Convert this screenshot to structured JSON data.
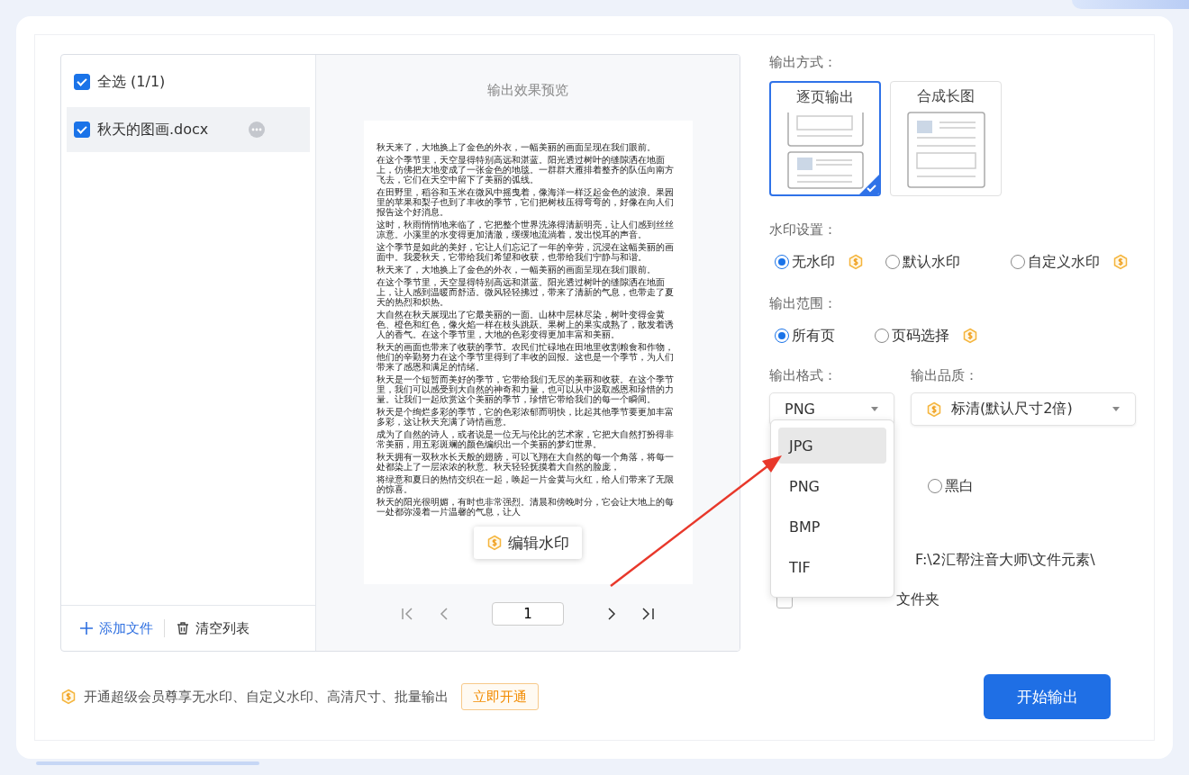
{
  "file_list": {
    "select_all": {
      "label": "全选 (1/1)",
      "checked": true
    },
    "files": [
      {
        "name": "秋天的图画.docx",
        "checked": true,
        "selected": true
      }
    ],
    "add_button": "添加文件",
    "clear_button": "清空列表"
  },
  "preview": {
    "title": "输出效果预览",
    "paragraphs": [
      "秋天来了，大地换上了金色的外衣，一幅美丽的画面呈现在我们眼前。",
      "在这个季节里，天空显得特别高远和湛蓝。阳光透过树叶的缝隙洒在地面上，仿佛把大地变成了一张金色的地毯。一群群大雁排着整齐的队伍向南方飞去，它们在天空中留下了美丽的弧线。",
      "在田野里，稻谷和玉米在微风中摇曳着，像海洋一样泛起金色的波浪。果园里的苹果和梨子也到了丰收的季节，它们把树枝压得弯弯的，好像在向人们报告这个好消息。",
      "这时，秋雨悄悄地来临了，它把整个世界洗涤得清新明亮，让人们感到丝丝凉意。小溪里的水变得更加清澈，缓缓地流淌着，发出悦耳的声音。",
      "这个季节是如此的美好，它让人们忘记了一年的辛劳，沉浸在这幅美丽的画面中。我爱秋天，它带给我们希望和收获，也带给我们宁静与和谐。",
      "秋天来了，大地换上了金色的外衣，一幅美丽的画面呈现在我们眼前。",
      "在这个季节里，天空显得特别高远和湛蓝。阳光透过树叶的缝隙洒在地面上，让人感到温暖而舒适。微风轻轻拂过，带来了清新的气息，也带走了夏天的热烈和炽热。",
      "大自然在秋天展现出了它最美丽的一面。山林中层林尽染，树叶变得金黄色、橙色和红色，像火焰一样在枝头跳跃。果树上的果实成熟了，散发着诱人的香气。在这个季节里，大地的色彩变得更加丰富和美丽。",
      "秋天的画面也带来了收获的季节。农民们忙碌地在田地里收割粮食和作物，他们的辛勤努力在这个季节里得到了丰收的回报。这也是一个季节，为人们带来了感恩和满足的情绪。",
      "秋天是一个短暂而美好的季节，它带给我们无尽的美丽和收获。在这个季节里，我们可以感受到大自然的神奇和力量，也可以从中汲取感恩和珍惜的力量。让我们一起欣赏这个美丽的季节，珍惜它带给我们的每一个瞬间。",
      "秋天是个绚烂多彩的季节，它的色彩浓郁而明快，比起其他季节要更加丰富多彩，这让秋天充满了诗情画意。",
      "成为了自然的诗人，或者说是一位无与伦比的艺术家，它把大自然打扮得非常美丽，用五彩斑斓的颜色编织出一个美丽的梦幻世界。",
      "秋天拥有一双秋水长天般的翅膀，可以飞翔在大自然的每一个角落，将每一处都染上了一层浓浓的秋意。秋天轻轻抚摸着大自然的脸庞，",
      "将绿意和夏日的热情交织在一起，唤起一片金黄与火红，给人们带来了无限的惊喜。",
      "秋天的阳光很明媚，有时也非常强烈。清晨和傍晚时分，它会让大地上的每一处都弥漫着一片温馨的气息，让人"
    ],
    "watermark_button": "编辑水印",
    "page": "1"
  },
  "output_mode": {
    "label": "输出方式：",
    "options": [
      {
        "label": "逐页输出",
        "kind": "pages",
        "selected": true
      },
      {
        "label": "合成长图",
        "kind": "long",
        "selected": false
      }
    ]
  },
  "watermark": {
    "label": "水印设置：",
    "options": [
      {
        "label": "无水印",
        "selected": true,
        "vip": true
      },
      {
        "label": "默认水印",
        "selected": false,
        "vip": false
      },
      {
        "label": "自定义水印",
        "selected": false,
        "vip": true
      }
    ]
  },
  "range": {
    "label": "输出范围：",
    "options": [
      {
        "label": "所有页",
        "selected": true,
        "vip": false
      },
      {
        "label": "页码选择",
        "selected": false,
        "vip": true
      }
    ]
  },
  "format": {
    "label": "输出格式：",
    "value": "PNG",
    "menu": [
      {
        "label": "JPG",
        "highlighted": true
      },
      {
        "label": "PNG",
        "highlighted": false
      },
      {
        "label": "BMP",
        "highlighted": false
      },
      {
        "label": "TIF",
        "highlighted": false
      }
    ]
  },
  "quality": {
    "label": "输出品质：",
    "value": "标清(默认尺寸2倍)",
    "vip": true
  },
  "color": {
    "options": [
      {
        "label": "黑白",
        "selected": false
      }
    ]
  },
  "directory": {
    "path": "F:\\2汇帮注音大师\\文件元素\\"
  },
  "subfolder": {
    "label": "文件夹",
    "checked": false
  },
  "promo": {
    "text": "开通超级会员尊享无水印、自定义水印、高清尺寸、批量输出",
    "button": "立即开通"
  },
  "start_button": "开始输出"
}
